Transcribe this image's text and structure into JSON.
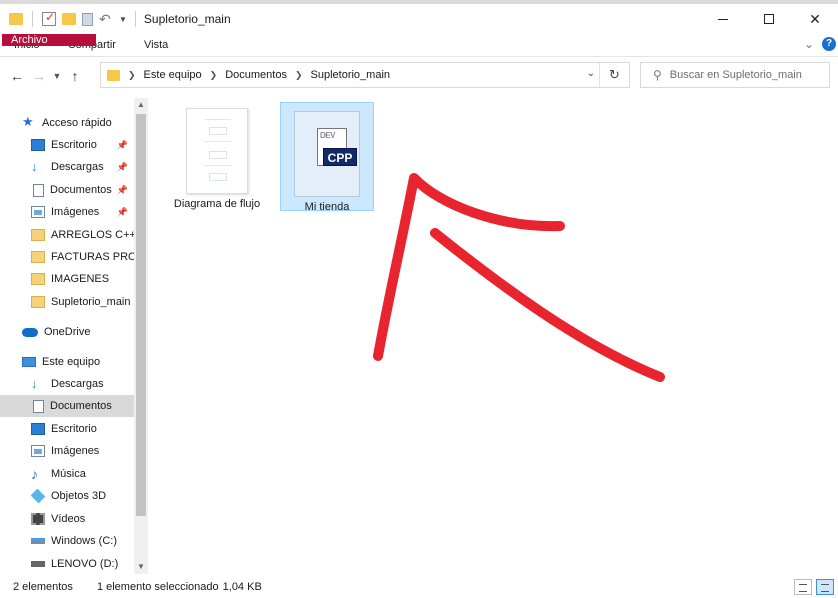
{
  "window": {
    "title": "Supletorio_main",
    "minimize_icon": "minimize-icon",
    "maximize_icon": "maximize-icon",
    "close_label": "✕"
  },
  "ribbon": {
    "tabs": [
      "Archivo",
      "Inicio",
      "Compartir",
      "Vista"
    ],
    "accent_color": "#b5103b"
  },
  "address": {
    "crumbs": [
      "Este equipo",
      "Documentos",
      "Supletorio_main"
    ]
  },
  "search": {
    "placeholder": "Buscar en Supletorio_main"
  },
  "sidebar": {
    "items": [
      {
        "label": "Acceso rápido",
        "icon": "star-icon"
      },
      {
        "label": "Escritorio",
        "icon": "desktop-icon",
        "pinned": true
      },
      {
        "label": "Descargas",
        "icon": "download-icon",
        "pinned": true
      },
      {
        "label": "Documentos",
        "icon": "document-icon",
        "pinned": true
      },
      {
        "label": "Imágenes",
        "icon": "image-icon",
        "pinned": true
      },
      {
        "label": "ARREGLOS C++",
        "icon": "folder-icon"
      },
      {
        "label": "FACTURAS PRODUCTOS",
        "icon": "folder-icon"
      },
      {
        "label": "IMAGENES",
        "icon": "folder-icon"
      },
      {
        "label": "Supletorio_main",
        "icon": "folder-icon"
      },
      {
        "label": "OneDrive",
        "icon": "cloud-icon"
      },
      {
        "label": "Este equipo",
        "icon": "pc-icon"
      },
      {
        "label": "Descargas",
        "icon": "download-icon"
      },
      {
        "label": "Documentos",
        "icon": "document-icon",
        "selected": true
      },
      {
        "label": "Escritorio",
        "icon": "desktop-icon"
      },
      {
        "label": "Imágenes",
        "icon": "image-icon"
      },
      {
        "label": "Música",
        "icon": "music-icon"
      },
      {
        "label": "Objetos 3D",
        "icon": "cube-icon"
      },
      {
        "label": "Vídeos",
        "icon": "video-icon"
      },
      {
        "label": "Windows (C:)",
        "icon": "drive-icon"
      },
      {
        "label": "LENOVO (D:)",
        "icon": "drive-icon"
      }
    ]
  },
  "files": [
    {
      "name": "Diagrama de flujo",
      "type": "document"
    },
    {
      "name": "Mi tienda",
      "type": "cpp",
      "badge": "CPP",
      "selected": true
    }
  ],
  "status": {
    "count": "2 elementos",
    "selected": "1 elemento seleccionado",
    "size": "1,04 KB"
  },
  "annotation": {
    "color": "#e8242e"
  }
}
